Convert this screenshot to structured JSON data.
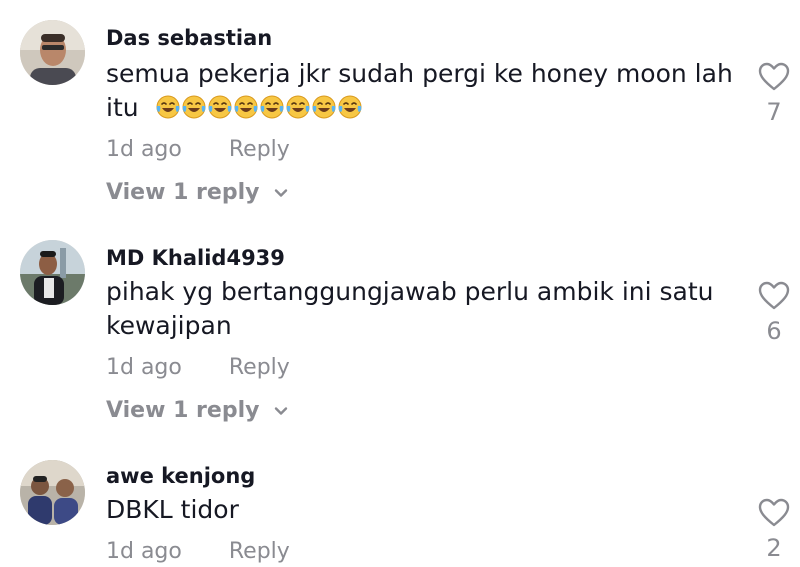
{
  "comments": [
    {
      "username": "Das sebastian",
      "text_line1": "semua pekerja jkr sudah pergi ke honey moon lah",
      "text_line2": "itu",
      "emoji_count": 8,
      "time": "1d ago",
      "reply_label": "Reply",
      "view_replies": "View 1 reply",
      "likes": "7"
    },
    {
      "username": "MD Khalid4939",
      "text_line1": "pihak yg bertanggungjawab perlu ambik ini satu",
      "text_line2": "kewajipan",
      "time": "1d ago",
      "reply_label": "Reply",
      "view_replies": "View 1 reply",
      "likes": "6"
    },
    {
      "username": "awe kenjong",
      "text_line1": "DBKL tidor",
      "time": "1d ago",
      "reply_label": "Reply",
      "likes": "2"
    }
  ],
  "icons": {
    "like": "heart-outline-icon",
    "expand": "chevron-down-icon",
    "emoji": "face-with-tears-of-joy"
  },
  "colors": {
    "text": "#161823",
    "muted": "#8a8b91"
  }
}
